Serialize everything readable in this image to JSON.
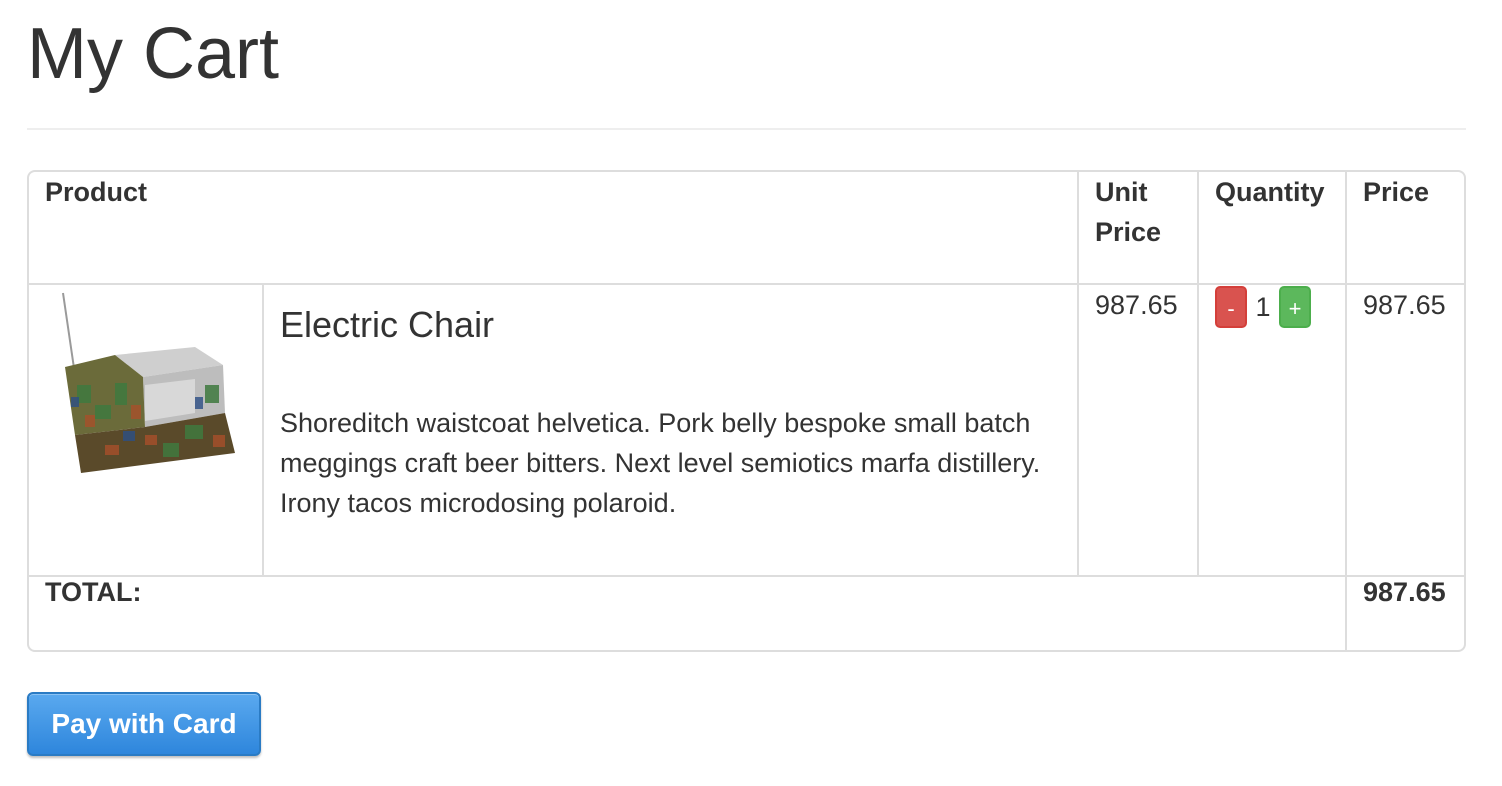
{
  "page": {
    "title": "My Cart"
  },
  "table": {
    "columns": {
      "product": "Product",
      "unit_price": "Unit Price",
      "quantity": "Quantity",
      "price": "Price"
    },
    "items": [
      {
        "name": "Electric Chair",
        "image_icon": "chair-thumbnail",
        "description": "Shoreditch waistcoat helvetica. Pork belly bespoke small batch meggings craft beer bitters. Next level semiotics marfa distillery. Irony tacos microdosing polaroid.",
        "unit_price": "987.65",
        "quantity": "1",
        "decrement_label": "-",
        "increment_label": "+",
        "price": "987.65"
      }
    ],
    "total_label": "TOTAL:",
    "total_value": "987.65"
  },
  "actions": {
    "pay_label": "Pay with Card"
  },
  "colors": {
    "minus_button": "#d9534f",
    "plus_button": "#5cb85c",
    "pay_button": "#3a8ee0",
    "border": "#dddddd",
    "text": "#333333"
  }
}
